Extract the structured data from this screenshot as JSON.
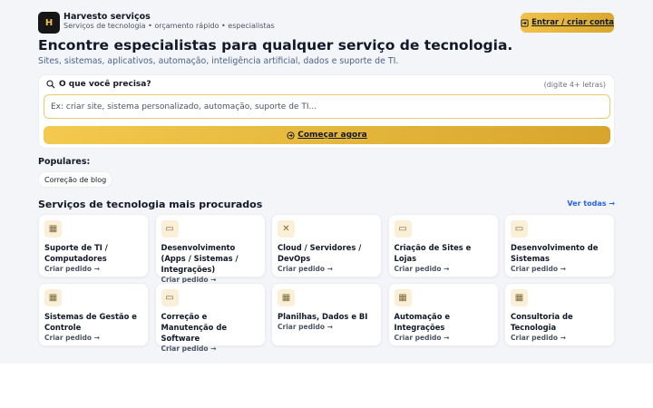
{
  "header": {
    "logo_letter": "H",
    "brand_name": "Harvesto serviços",
    "tagline": "Serviços de tecnologia • orçamento rápido • especialistas",
    "login_icon": "login-arrow-icon",
    "login_label": "Entrar / criar conta"
  },
  "hero": {
    "title": "Encontre especialistas para qualquer serviço de tecnologia.",
    "subtitle": "Sites, sistemas, aplicativos, automação, inteligência artificial, dados e suporte de TI."
  },
  "search": {
    "label": "O que você precisa?",
    "hint": "(digite 4+ letras)",
    "placeholder": "Ex: criar site, sistema personalizado, automação, suporte de TI...",
    "value": "",
    "button_label": "Começar agora"
  },
  "popular": {
    "title": "Populares:",
    "chips": [
      "Correção de blog"
    ]
  },
  "services": {
    "title": "Serviços de tecnologia mais procurados",
    "see_all": "Ver todas →",
    "cards": [
      {
        "icon": "grid-icon",
        "glyph": "▦",
        "title": "Suporte de TI / Computadores",
        "link": "Criar pedido →"
      },
      {
        "icon": "laptop-icon",
        "glyph": "▭",
        "title": "Desenvolvimento (Apps / Sistemas / Integrações)",
        "link": "Criar pedido →"
      },
      {
        "icon": "tools-icon",
        "glyph": "✕",
        "title": "Cloud / Servidores / DevOps",
        "link": "Criar pedido →"
      },
      {
        "icon": "laptop-icon",
        "glyph": "▭",
        "title": "Criação de Sites e Lojas",
        "link": "Criar pedido →"
      },
      {
        "icon": "laptop-icon",
        "glyph": "▭",
        "title": "Desenvolvimento de Sistemas",
        "link": "Criar pedido →"
      },
      {
        "icon": "grid-icon",
        "glyph": "▦",
        "title": "Sistemas de Gestão e Controle",
        "link": "Criar pedido →"
      },
      {
        "icon": "laptop-icon",
        "glyph": "▭",
        "title": "Correção e Manutenção de Software",
        "link": "Criar pedido →"
      },
      {
        "icon": "grid-icon",
        "glyph": "▦",
        "title": "Planilhas, Dados e BI",
        "link": "Criar pedido →"
      },
      {
        "icon": "grid-icon",
        "glyph": "▦",
        "title": "Automação e Integrações",
        "link": "Criar pedido →"
      },
      {
        "icon": "grid-icon",
        "glyph": "▦",
        "title": "Consultoria de Tecnologia",
        "link": "Criar pedido →"
      }
    ]
  },
  "colors": {
    "accent_gold": "#f1c24a",
    "link_blue": "#2563eb",
    "page_bg": "#f4f5f8"
  }
}
